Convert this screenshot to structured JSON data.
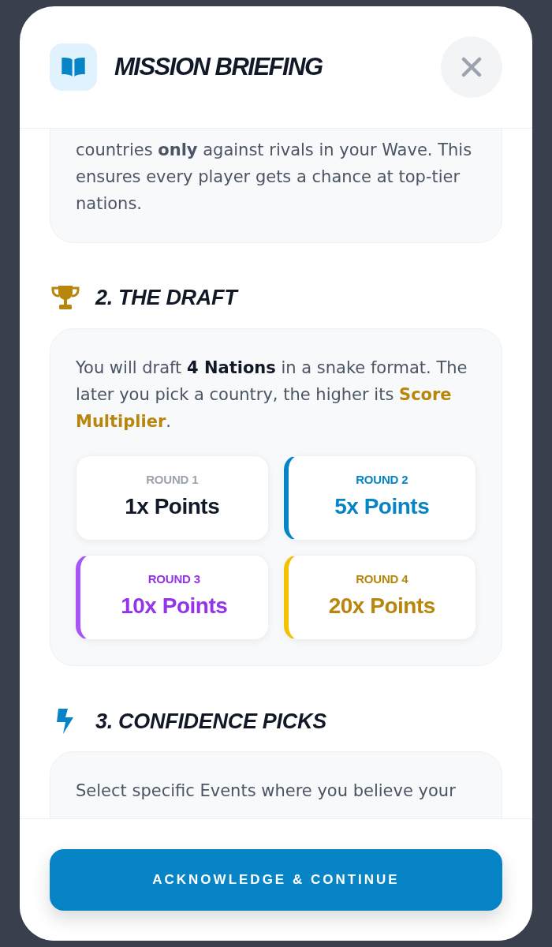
{
  "header": {
    "title": "MISSION BRIEFING"
  },
  "wave_card": {
    "text": "countries **only** against rivals in your Wave. This ensures every player gets a chance at top-tier nations."
  },
  "draft": {
    "heading": "2. THE DRAFT",
    "text": "You will draft **4 Nations** in a snake format. The later you pick a country, the higher its **Score Multiplier**.",
    "rounds": [
      {
        "kind": "plain",
        "label": "ROUND 1",
        "value": "1x Points"
      },
      {
        "kind": "boost",
        "label": "ROUND 2",
        "value": "5x Points",
        "color": "#0784c6",
        "accent": {
          "color": "#0784c6"
        }
      },
      {
        "kind": "boost",
        "label": "ROUND 3",
        "value": "10x Points",
        "color": "#9333ea",
        "accent": {
          "color": "#a855f7"
        }
      },
      {
        "kind": "boost",
        "label": "ROUND 4",
        "value": "20x Points",
        "color": "#b8860b",
        "accent": {
          "color": "#f2c200"
        }
      }
    ]
  },
  "confidence": {
    "heading": "3. CONFIDENCE PICKS",
    "text": "Select specific Events where you believe your"
  },
  "footer": {
    "button": "ACKNOWLEDGE & CONTINUE"
  }
}
